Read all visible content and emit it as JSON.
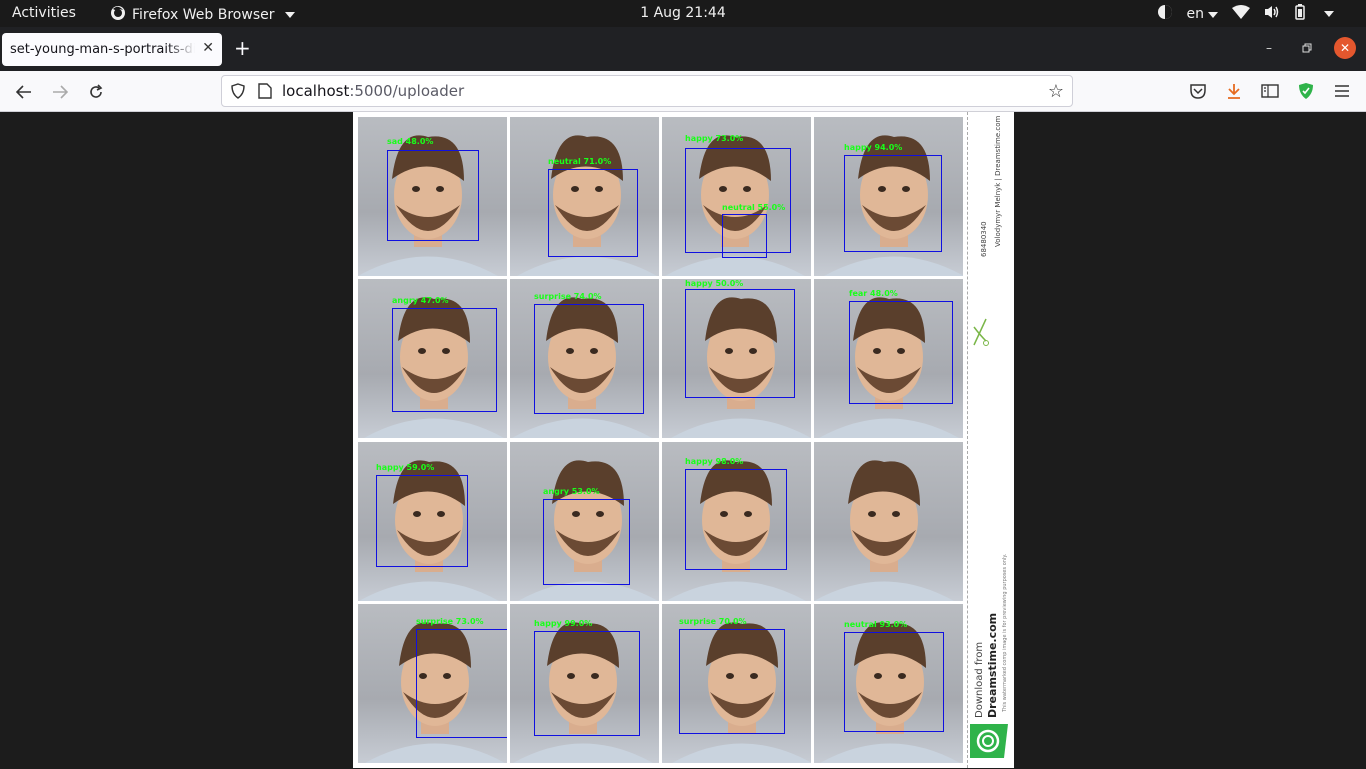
{
  "topbar": {
    "activities": "Activities",
    "app_name": "Firefox Web Browser",
    "clock": "1 Aug  21:44",
    "language": "en"
  },
  "tab": {
    "title": "set-young-man-s-portraits-di",
    "new_tab": "+"
  },
  "navbar": {
    "url_host": "localhost",
    "url_path": ":5000/uploader"
  },
  "sheet": {
    "image_id": "68480340",
    "author": "Volodymyr Melnyk | Dreamstime.com",
    "download_from": "Download from",
    "brand": "Dreamstime.com",
    "disclaimer": "This watermarked comp image is for previewing purposes only."
  },
  "detections": [
    [
      {
        "label": "sad 48.0%"
      }
    ],
    [
      {
        "label": "neutral 71.0%"
      }
    ],
    [
      {
        "label": "happy 73.0%"
      },
      {
        "label": "neutral 55.0%"
      }
    ],
    [
      {
        "label": "happy 94.0%"
      }
    ],
    [
      {
        "label": "angry 47.0%"
      }
    ],
    [
      {
        "label": "surprise 74.0%"
      }
    ],
    [
      {
        "label": "happy 50.0%"
      }
    ],
    [
      {
        "label": "fear 48.0%"
      }
    ],
    [
      {
        "label": "happy 59.0%"
      }
    ],
    [
      {
        "label": "angry 53.0%"
      }
    ],
    [
      {
        "label": "happy 98.0%"
      }
    ],
    [],
    [
      {
        "label": "surprise 73.0%"
      }
    ],
    [
      {
        "label": "happy 99.0%"
      }
    ],
    [
      {
        "label": "surprise 70.0%"
      }
    ],
    [
      {
        "label": "neutral 93.0%"
      }
    ]
  ],
  "colors": {
    "box": "#1010e0",
    "label": "#19ff19",
    "accent_download": "#e66b20",
    "accent_extension": "#2fb34a"
  }
}
